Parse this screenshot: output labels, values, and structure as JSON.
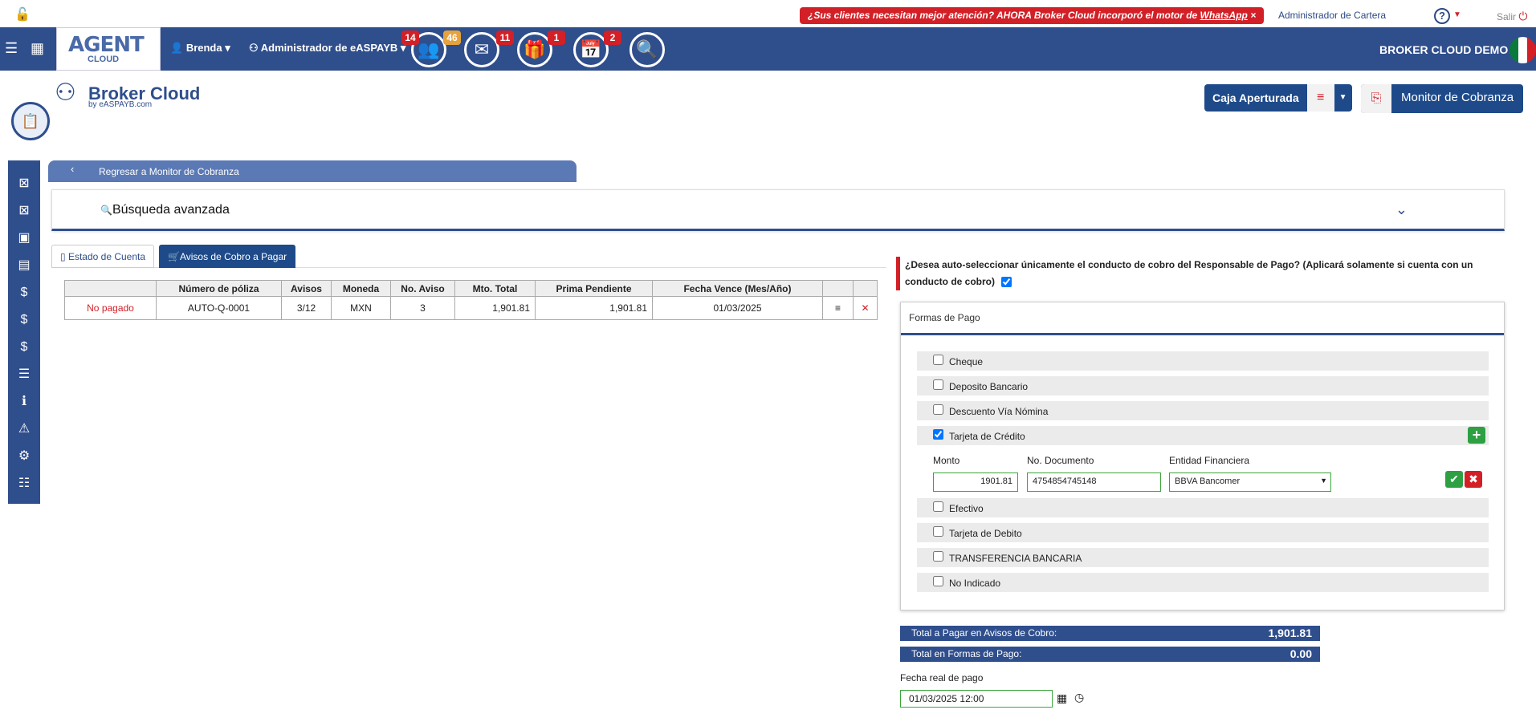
{
  "topbar": {
    "promo_text": "¿Sus clientes necesitan mejor atención? AHORA Broker Cloud incorporó el motor de",
    "promo_link": "WhatsApp",
    "promo_close": "×",
    "role_text": "Administrador de Cartera",
    "help": "?",
    "salir": "Salir"
  },
  "navbar": {
    "logo_main": "AGENT",
    "logo_sub": "CLOUD",
    "user": "Brenda",
    "admin": "Administrador de eASPAYB",
    "badges": [
      "14",
      "46",
      "11",
      "1",
      "2"
    ],
    "demo": "BROKER CLOUD DEMO"
  },
  "brand": {
    "title": "Broker Cloud",
    "subtitle": "by eASPAYB.com"
  },
  "actions": {
    "caja": "Caja Aperturada",
    "monitor": "Monitor de Cobranza"
  },
  "back": {
    "label": "Regresar a Monitor de Cobranza"
  },
  "search": {
    "label": "Búsqueda avanzada"
  },
  "tabs": {
    "estado": "Estado de Cuenta",
    "avisos": "Avisos de Cobro a Pagar"
  },
  "table": {
    "headers": [
      "",
      "Número de póliza",
      "Avisos",
      "Moneda",
      "No. Aviso",
      "Mto. Total",
      "Prima Pendiente",
      "Fecha Vence (Mes/Año)",
      "",
      ""
    ],
    "row": {
      "status": "No pagado",
      "poliza": "AUTO-Q-0001",
      "avisos": "3/12",
      "moneda": "MXN",
      "no_aviso": "3",
      "total": "1,901.81",
      "prima": "1,901.81",
      "fecha": "01/03/2025"
    }
  },
  "question": "¿Desea auto-seleccionar únicamente el conducto de cobro del Responsable de Pago? (Aplicará solamente si cuenta con un conducto de cobro)",
  "formas": {
    "title": "Formas de Pago",
    "options": [
      "Cheque",
      "Deposito Bancario",
      "Descuento Vía Nómina",
      "Tarjeta de Crédito",
      "Efectivo",
      "Tarjeta de Debito",
      "TRANSFERENCIA BANCARIA",
      "No Indicado"
    ],
    "detail": {
      "monto_label": "Monto",
      "monto": "1901.81",
      "doc_label": "No. Documento",
      "doc": "4754854745148",
      "entidad_label": "Entidad Financiera",
      "entidad": "BBVA Bancomer"
    }
  },
  "totals": {
    "avisos_label": "Total a Pagar en Avisos de Cobro:",
    "avisos": "1,901.81",
    "formas_label": "Total en Formas de Pago:",
    "formas": "0.00"
  },
  "fecha": {
    "label": "Fecha real de pago",
    "value": "01/03/2025 12:00"
  }
}
